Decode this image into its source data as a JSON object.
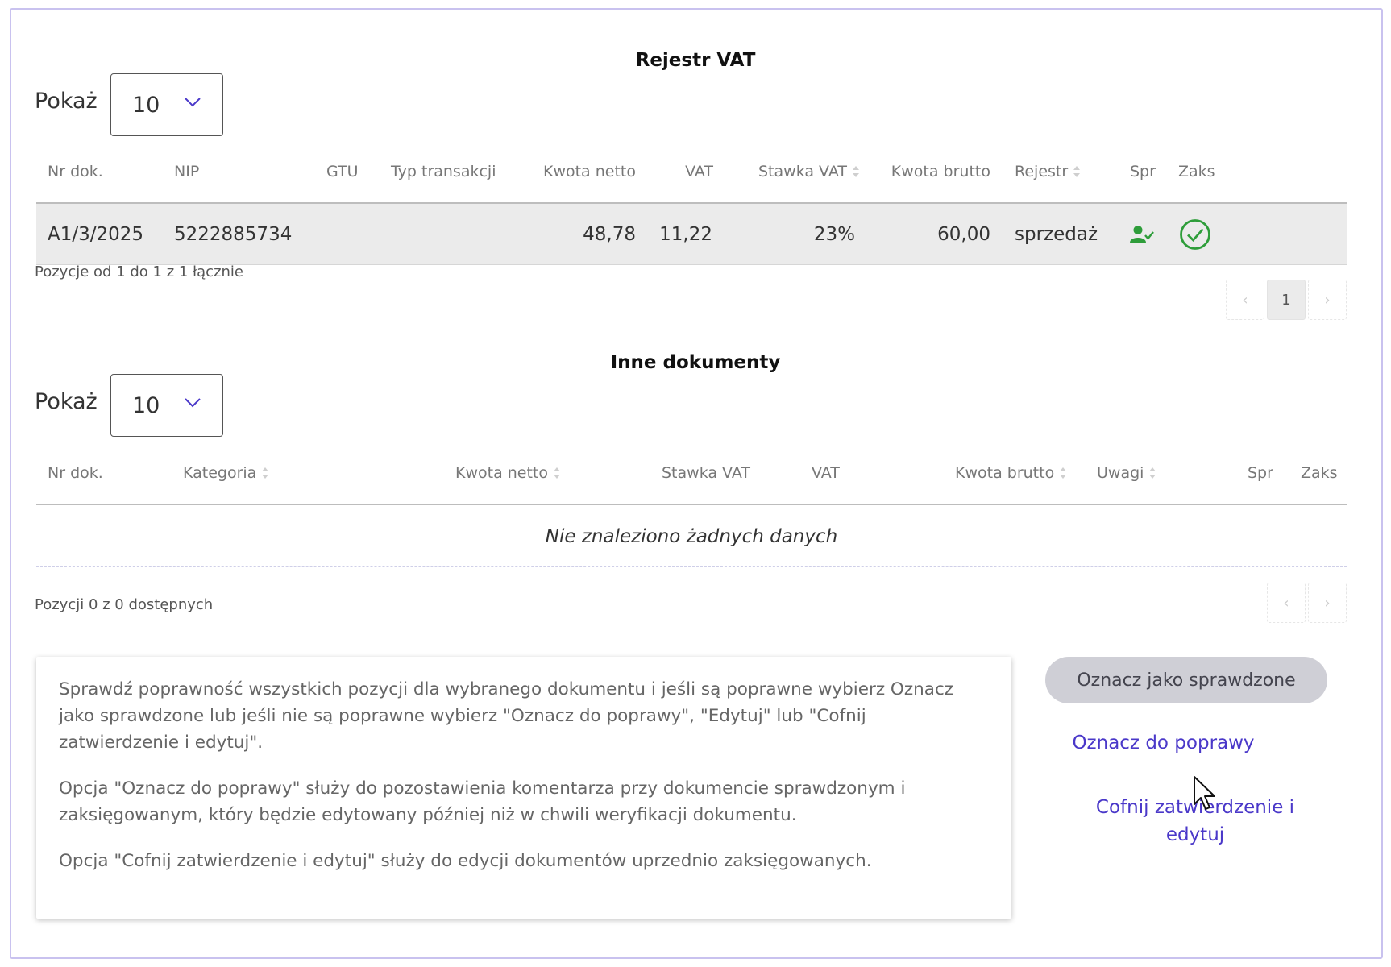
{
  "vat_register": {
    "title": "Rejestr VAT",
    "show_label": "Pokaż",
    "page_size": "10",
    "columns": [
      "Nr dok.",
      "NIP",
      "GTU",
      "Typ transakcji",
      "Kwota netto",
      "VAT",
      "Stawka VAT",
      "Kwota brutto",
      "Rejestr",
      "Spr",
      "Zaks"
    ],
    "rows": [
      {
        "doc_no": "A1/3/2025",
        "nip": "5222885734",
        "gtu": "",
        "transaction_type": "",
        "net": "48,78",
        "vat": "11,22",
        "vat_rate": "23%",
        "gross": "60,00",
        "register": "sprzedaż",
        "checked_icon": "user-check-icon",
        "booked_icon": "check-circle-icon"
      }
    ],
    "info": "Pozycje od 1 do 1 z 1 łącznie",
    "pager": {
      "prev": "‹",
      "current": "1",
      "next": "›"
    }
  },
  "other_documents": {
    "title": "Inne dokumenty",
    "show_label": "Pokaż",
    "page_size": "10",
    "columns": [
      "Nr dok.",
      "Kategoria",
      "Kwota netto",
      "Stawka VAT",
      "VAT",
      "Kwota brutto",
      "Uwagi",
      "Spr",
      "Zaks"
    ],
    "empty_message": "Nie znaleziono żadnych danych",
    "info": "Pozycji 0 z 0 dostępnych",
    "pager": {
      "prev": "‹",
      "next": "›"
    }
  },
  "help": {
    "paragraphs": [
      "Sprawdź poprawność wszystkich pozycji dla wybranego dokumentu i jeśli są poprawne wybierz Oznacz jako sprawdzone lub jeśli nie są poprawne wybierz \"Oznacz do poprawy\", \"Edytuj\" lub \"Cofnij zatwierdzenie i edytuj\".",
      "Opcja \"Oznacz do poprawy\" służy do pozostawienia komentarza przy dokumencie sprawdzonym i zaksięgowanym, który będzie edytowany później niż w chwili weryfikacji dokumentu.",
      "Opcja \"Cofnij zatwierdzenie i edytuj\" służy do edycji dokumentów uprzednio zaksięgowanych."
    ]
  },
  "actions": {
    "mark_checked": "Oznacz jako sprawdzone",
    "mark_for_correction": "Oznacz do poprawy",
    "revoke_and_edit": "Cofnij zatwierdzenie i edytuj"
  },
  "colors": {
    "accent": "#4a38c9",
    "success": "#2e9d3a",
    "frame": "#c9c2ef"
  }
}
